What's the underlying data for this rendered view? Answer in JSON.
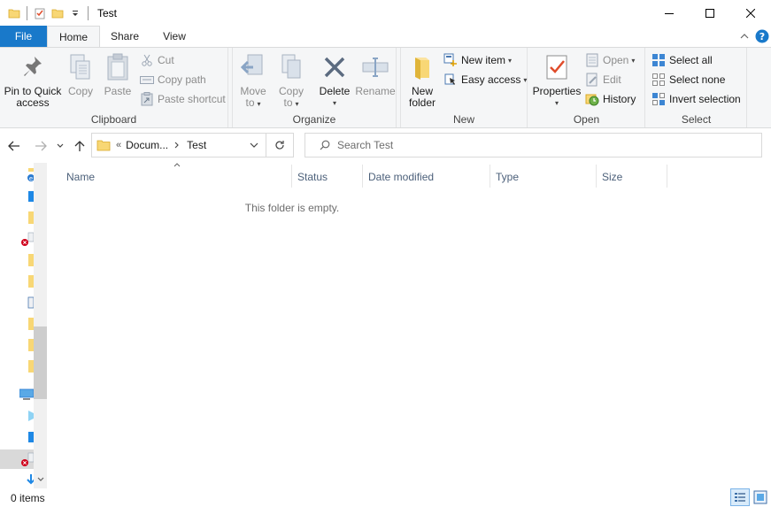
{
  "window": {
    "title": "Test",
    "controls": [
      "minimize-icon",
      "maximize-icon",
      "close-icon"
    ]
  },
  "tabs": [
    {
      "label": "File"
    },
    {
      "label": "Home"
    },
    {
      "label": "Share"
    },
    {
      "label": "View"
    }
  ],
  "ribbon": {
    "clipboard": {
      "label": "Clipboard",
      "pin_label_1": "Pin to Quick",
      "pin_label_2": "access",
      "copy": "Copy",
      "paste": "Paste",
      "cut": "Cut",
      "copy_path": "Copy path",
      "paste_shortcut": "Paste shortcut"
    },
    "organize": {
      "label": "Organize",
      "move_1": "Move",
      "move_2": "to",
      "copy_1": "Copy",
      "copy_2": "to",
      "delete": "Delete",
      "rename": "Rename"
    },
    "new": {
      "label": "New",
      "new_folder_1": "New",
      "new_folder_2": "folder",
      "new_item": "New item",
      "easy_access": "Easy access"
    },
    "open": {
      "label": "Open",
      "properties": "Properties",
      "open": "Open",
      "edit": "Edit",
      "history": "History"
    },
    "select": {
      "label": "Select",
      "select_all": "Select all",
      "select_none": "Select none",
      "invert": "Invert selection"
    }
  },
  "address": {
    "prefix": "«",
    "crumb1": "Docum...",
    "crumb2": "Test",
    "search_placeholder": "Search Test"
  },
  "columns": [
    "Name",
    "Status",
    "Date modified",
    "Type",
    "Size"
  ],
  "empty_message": "This folder is empty.",
  "status": {
    "items": "0 items"
  },
  "colors": {
    "accent": "#1979ca",
    "ribbon_bg": "#f5f6f7",
    "folder": "#f8d775"
  }
}
